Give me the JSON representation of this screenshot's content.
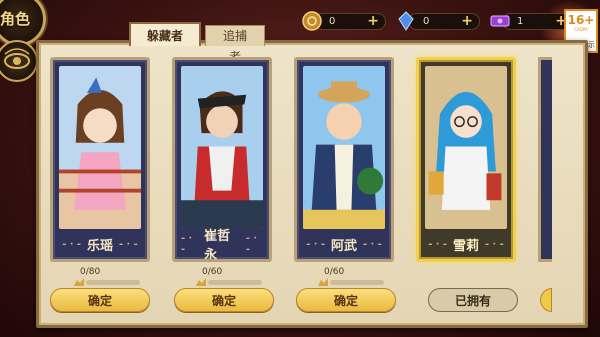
{
  "header": {
    "role_title": "角色"
  },
  "currencies": [
    {
      "icon": "coin-icon",
      "value": "0",
      "plus": "+"
    },
    {
      "icon": "blue-crystal-icon",
      "value": "0",
      "plus": "+"
    },
    {
      "icon": "purple-ticket-icon",
      "value": "1",
      "plus": "+"
    }
  ],
  "age_badge": {
    "rating": "16+",
    "sub": "CADPA",
    "tip": "适龄提示"
  },
  "tabs": [
    {
      "label": "躲藏者",
      "active": true
    },
    {
      "label": "追捕者",
      "active": false
    }
  ],
  "cards": [
    {
      "name": "乐瑶",
      "progress": "0/80",
      "button": "确定",
      "owned": false,
      "selected": false
    },
    {
      "name": "崔哲永",
      "progress": "0/60",
      "button": "确定",
      "owned": false,
      "selected": false
    },
    {
      "name": "阿武",
      "progress": "0/60",
      "button": "确定",
      "owned": false,
      "selected": false
    },
    {
      "name": "雪莉",
      "progress": "",
      "button": "已拥有",
      "owned": true,
      "selected": true
    }
  ],
  "colors": {
    "accent": "#f0cf52",
    "confirm_button": "#eab940",
    "card_bg": "#31345a",
    "panel_bg": "#efe4c9"
  }
}
